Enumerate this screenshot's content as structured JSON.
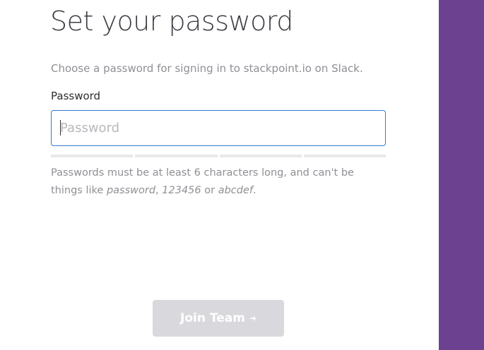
{
  "heading": "Set your password",
  "subtitle": "Choose a password for signing in to stackpoint.io on Slack.",
  "password_field": {
    "label": "Password",
    "placeholder": "Password",
    "value": ""
  },
  "strength_meter": {
    "segments": 4,
    "filled": 0
  },
  "hint": {
    "prefix": "Passwords must be at least 6 characters long, and can't be things like ",
    "example_1": "password",
    "sep_1": ", ",
    "example_2": "123456",
    "sep_2": " or ",
    "example_3": "abcdef",
    "suffix": "."
  },
  "join_button": {
    "label": "Join Team",
    "icon": "arrow-right-icon",
    "enabled": false
  },
  "colors": {
    "accent_purple": "#6c4190",
    "input_border_focus": "#2e7cd1",
    "button_disabled": "#d9d9dd"
  }
}
